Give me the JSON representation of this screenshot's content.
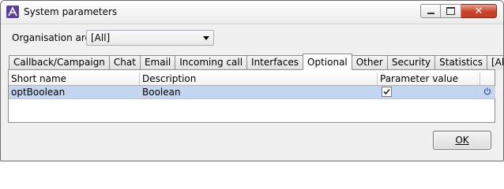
{
  "window": {
    "title": "System parameters",
    "controls": {
      "minimize_icon": "minimize-icon",
      "maximize_icon": "maximize-icon",
      "close_icon": "close-icon",
      "close_glyph": "✕"
    }
  },
  "filter": {
    "label": "Organisation area",
    "selected": "[All]"
  },
  "tabs": [
    {
      "label": "Callback/Campaign",
      "active": false
    },
    {
      "label": "Chat",
      "active": false
    },
    {
      "label": "Email",
      "active": false
    },
    {
      "label": "Incoming call",
      "active": false
    },
    {
      "label": "Interfaces",
      "active": false
    },
    {
      "label": "Optional",
      "active": true
    },
    {
      "label": "Other",
      "active": false
    },
    {
      "label": "Security",
      "active": false
    },
    {
      "label": "Statistics",
      "active": false
    },
    {
      "label": "[All]",
      "active": false
    }
  ],
  "grid": {
    "columns": [
      "Short name",
      "Description",
      "Parameter value"
    ],
    "rows": [
      {
        "short_name": "optBoolean",
        "description": "Boolean",
        "value_checked": true,
        "action_icon": "power-icon"
      }
    ]
  },
  "footer": {
    "ok_label": "OK"
  },
  "colors": {
    "selected_row": "#c3d5f1",
    "close_button": "#c7432a",
    "app_icon": "#5b3f9a"
  }
}
